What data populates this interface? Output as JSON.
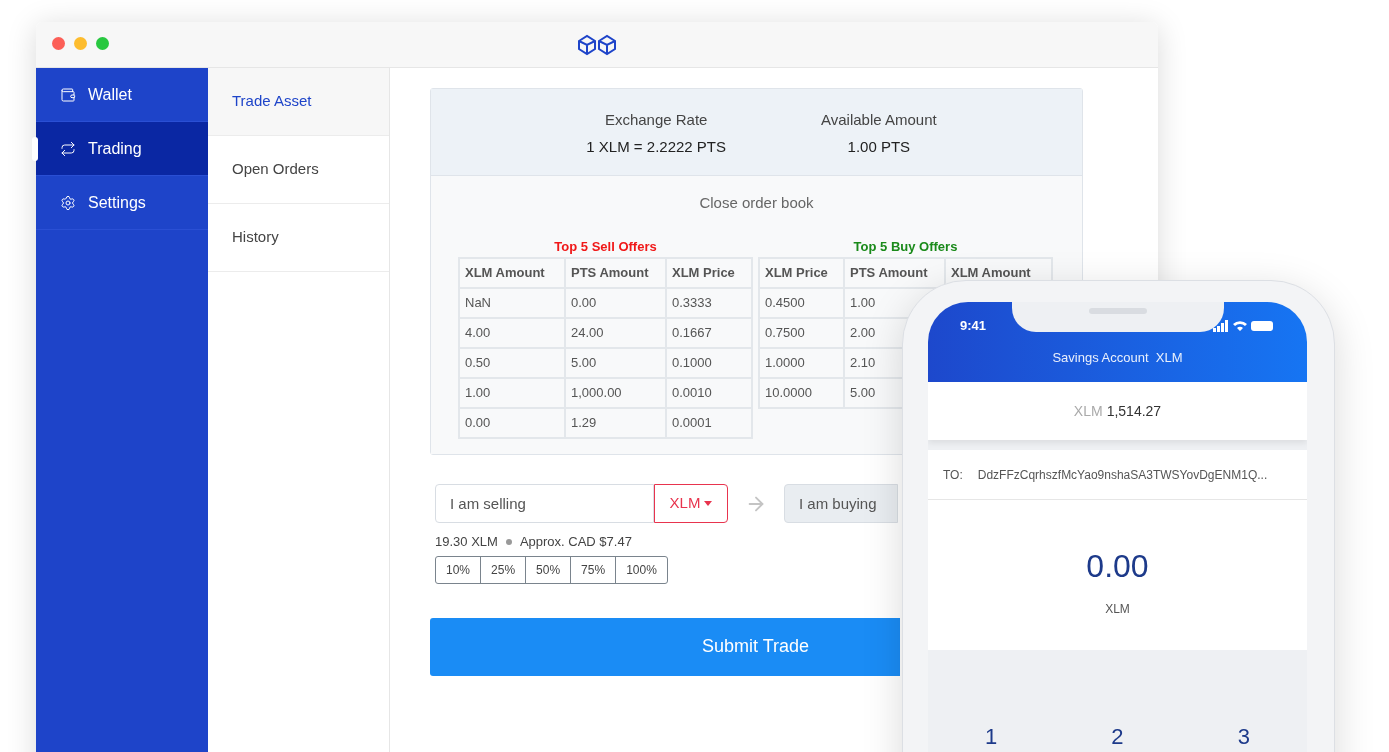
{
  "sidebar": {
    "items": [
      {
        "label": "Wallet",
        "selected": false
      },
      {
        "label": "Trading",
        "selected": true
      },
      {
        "label": "Settings",
        "selected": false
      }
    ]
  },
  "subnav": {
    "items": [
      {
        "label": "Trade Asset",
        "selected": true
      },
      {
        "label": "Open Orders",
        "selected": false
      },
      {
        "label": "History",
        "selected": false
      }
    ]
  },
  "summary": [
    {
      "label": "Exchange Rate",
      "value": "1 XLM = 2.2222 PTS"
    },
    {
      "label": "Available Amount",
      "value": "1.00 PTS"
    }
  ],
  "order_book": {
    "toggle": "Close order book",
    "sell": {
      "title": "Top 5 Sell Offers",
      "columns": [
        "XLM Amount",
        "PTS Amount",
        "XLM Price"
      ],
      "rows": [
        [
          "NaN",
          "0.00",
          "0.3333"
        ],
        [
          "4.00",
          "24.00",
          "0.1667"
        ],
        [
          "0.50",
          "5.00",
          "0.1000"
        ],
        [
          "1.00",
          "1,000.00",
          "0.0010"
        ],
        [
          "0.00",
          "1.29",
          "0.0001"
        ]
      ]
    },
    "buy": {
      "title": "Top 5 Buy Offers",
      "columns": [
        "XLM Price",
        "PTS Amount",
        "XLM Amount"
      ],
      "rows": [
        [
          "0.4500",
          "1.00"
        ],
        [
          "0.7500",
          "2.00"
        ],
        [
          "1.0000",
          "2.10"
        ],
        [
          "10.0000",
          "5.00"
        ]
      ]
    }
  },
  "trade_form": {
    "selling": {
      "placeholder": "I am selling"
    },
    "currency": "XLM",
    "buying": {
      "placeholder": "I am buying"
    },
    "balance": "19.30 XLM",
    "approx": "Approx. CAD $7.47",
    "percent_buttons": [
      "10%",
      "25%",
      "50%",
      "75%",
      "100%"
    ],
    "submit": "Submit Trade"
  },
  "phone": {
    "time": "9:41",
    "title": "Savings Account  XLM",
    "balance_unit": "XLM",
    "balance": "1,514.27",
    "to_label": "TO:",
    "to_address": "DdzFFzCqrhszfMcYao9nshaSA3TWSYovDgENM1Q...",
    "amount": "0.00",
    "amount_unit": "XLM",
    "keys": [
      "1",
      "2",
      "3"
    ]
  }
}
